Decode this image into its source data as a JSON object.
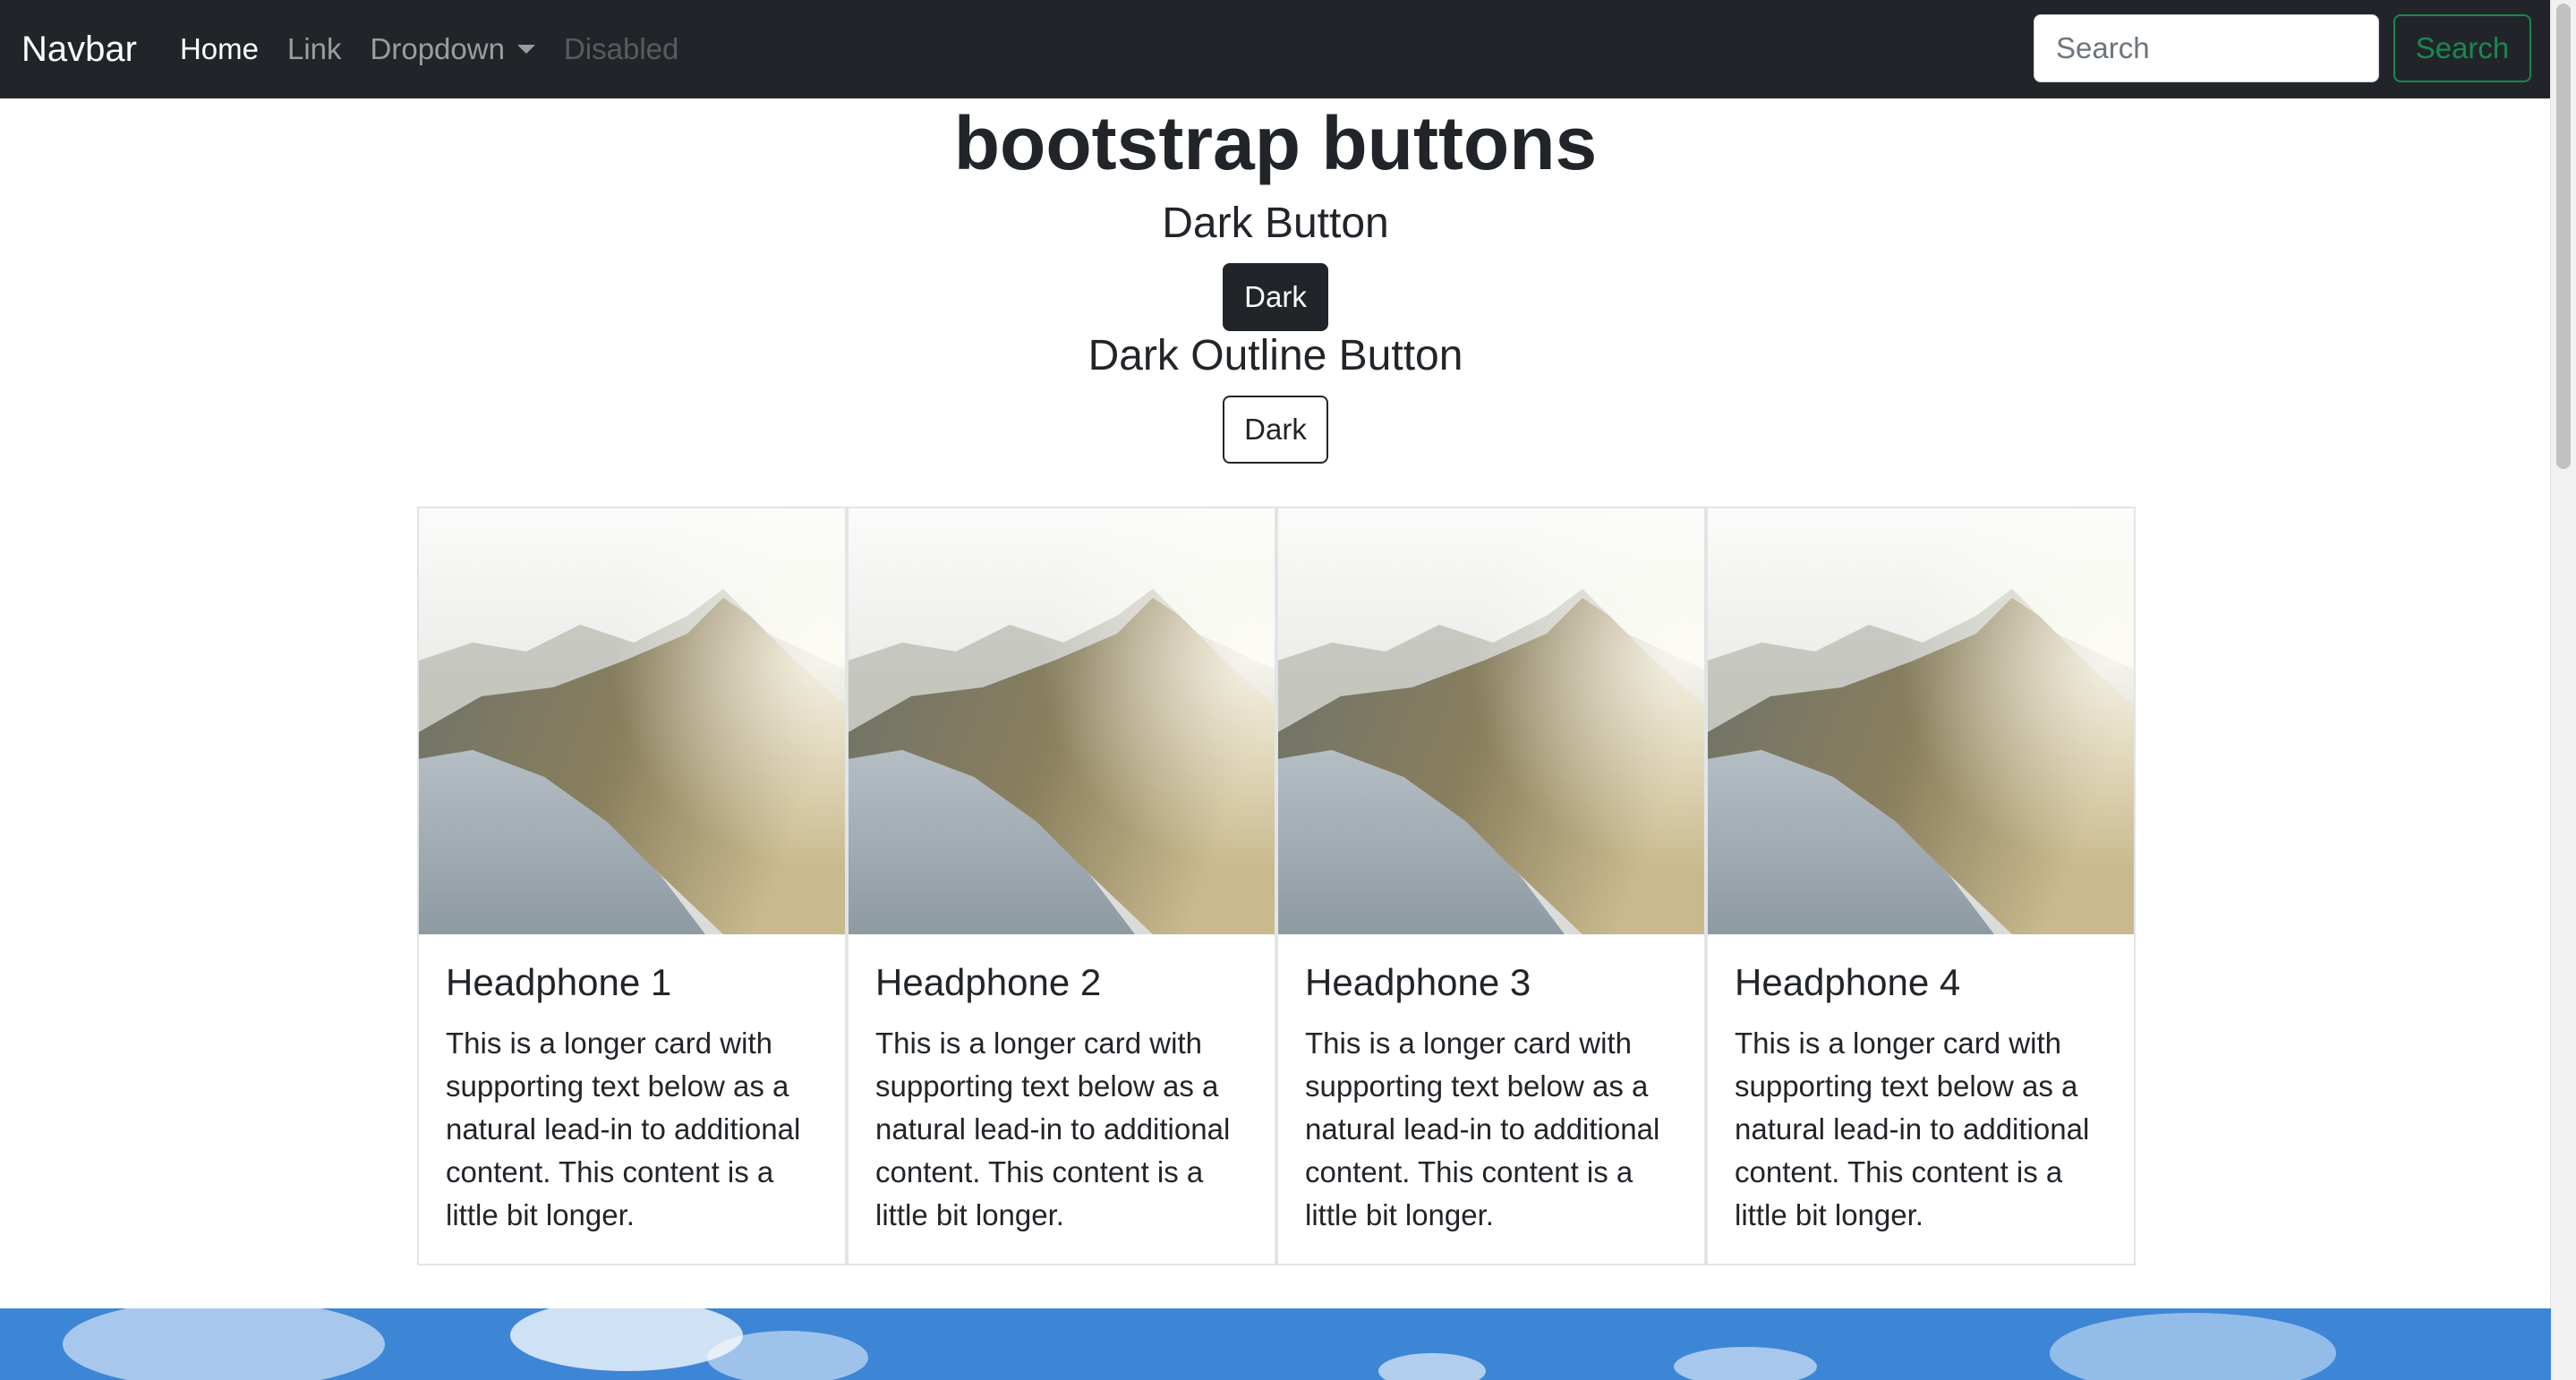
{
  "navbar": {
    "brand": "Navbar",
    "links": [
      {
        "label": "Home"
      },
      {
        "label": "Link"
      },
      {
        "label": "Dropdown"
      },
      {
        "label": "Disabled"
      }
    ],
    "search": {
      "placeholder": "Search",
      "button_label": "Search"
    }
  },
  "main": {
    "title": "bootstrap buttons",
    "dark_section": {
      "heading": "Dark Button",
      "button_label": "Dark"
    },
    "outline_section": {
      "heading": "Dark Outline Button",
      "button_label": "Dark"
    }
  },
  "cards": [
    {
      "title": "Headphone 1",
      "text": "This is a longer card with supporting text below as a natural lead-in to additional content. This content is a little bit longer."
    },
    {
      "title": "Headphone 2",
      "text": "This is a longer card with supporting text below as a natural lead-in to additional content. This content is a little bit longer."
    },
    {
      "title": "Headphone 3",
      "text": "This is a longer card with supporting text below as a natural lead-in to additional content. This content is a little bit longer."
    },
    {
      "title": "Headphone 4",
      "text": "This is a longer card with supporting text below as a natural lead-in to additional content. This content is a little bit longer."
    }
  ],
  "colors": {
    "navbar_bg": "#212529",
    "success": "#198754",
    "dark": "#212529"
  }
}
